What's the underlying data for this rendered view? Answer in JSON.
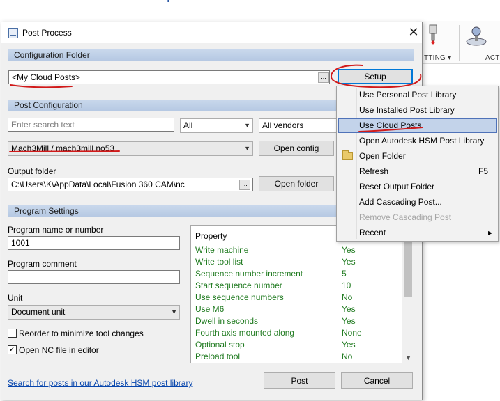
{
  "background": {
    "ribbon_label_1": "TTING ▾",
    "ribbon_label_2": "ACT"
  },
  "dialog": {
    "title": "Post Process",
    "close_glyph": "✕",
    "config_folder": {
      "header": "Configuration Folder",
      "value": "<My Cloud Posts>",
      "browse": "...",
      "setup_button": "Setup"
    },
    "post_config": {
      "header": "Post Configuration",
      "search_placeholder": "Enter search text",
      "filter_all": "All",
      "filter_vendors": "All vendors",
      "post_selected": "Mach3Mill / mach3mill no53",
      "open_config_button": "Open config",
      "output_folder_label": "Output folder",
      "output_folder_value": "C:\\Users\\K\\AppData\\Local\\Fusion 360 CAM\\nc",
      "output_browse": "...",
      "open_folder_button": "Open folder"
    },
    "program_settings": {
      "header": "Program Settings",
      "program_name_label": "Program name or number",
      "program_name_value": "1001",
      "program_comment_label": "Program comment",
      "program_comment_value": "",
      "unit_label": "Unit",
      "unit_value": "Document unit",
      "reorder_label": "Reorder to minimize tool changes",
      "reorder_checked": false,
      "open_nc_label": "Open NC file in editor",
      "open_nc_checked": true,
      "property_header": "Property",
      "properties": [
        {
          "key": "Write machine",
          "value": "Yes"
        },
        {
          "key": "Write tool list",
          "value": "Yes"
        },
        {
          "key": "Sequence number increment",
          "value": "5"
        },
        {
          "key": "Start sequence number",
          "value": "10"
        },
        {
          "key": "Use sequence numbers",
          "value": "No"
        },
        {
          "key": "Use M6",
          "value": "Yes"
        },
        {
          "key": "Dwell in seconds",
          "value": "Yes"
        },
        {
          "key": "Fourth axis mounted along",
          "value": "None"
        },
        {
          "key": "Optional stop",
          "value": "Yes"
        },
        {
          "key": "Preload tool",
          "value": "No"
        }
      ]
    },
    "footer": {
      "search_link": "Search for posts in our Autodesk HSM post library",
      "post_button": "Post",
      "cancel_button": "Cancel"
    }
  },
  "context_menu": {
    "items": [
      {
        "label": "Use Personal Post Library",
        "shortcut": "",
        "state": "normal"
      },
      {
        "label": "Use Installed Post Library",
        "shortcut": "",
        "state": "normal"
      },
      {
        "label": "Use Cloud Posts",
        "shortcut": "",
        "state": "selected"
      },
      {
        "label": "Open Autodesk HSM Post Library",
        "shortcut": "",
        "state": "normal"
      },
      {
        "label": "Open Folder",
        "shortcut": "",
        "state": "normal",
        "icon": "folder-icon"
      },
      {
        "label": "Refresh",
        "shortcut": "F5",
        "state": "normal"
      },
      {
        "label": "Reset Output Folder",
        "shortcut": "",
        "state": "normal"
      },
      {
        "label": "Add Cascading Post...",
        "shortcut": "",
        "state": "normal"
      },
      {
        "label": "Remove Cascading Post",
        "shortcut": "",
        "state": "disabled"
      },
      {
        "label": "Recent",
        "shortcut": "▸",
        "state": "normal"
      }
    ]
  },
  "colors": {
    "section_header": "#b6c9e3",
    "property_text": "#1f7a1f",
    "link": "#0645ad",
    "menu_highlight": "#c3d3ea",
    "annotation_red": "#d11a1a",
    "default_button_border": "#0078d7"
  }
}
